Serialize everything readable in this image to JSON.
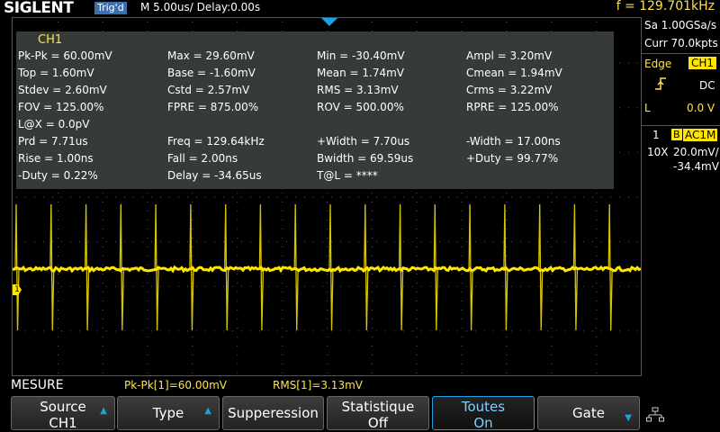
{
  "header": {
    "brand": "SIGLENT",
    "trigger_status": "Trig'd",
    "timebase": "M 5.00us/",
    "delay": "Delay:0.00s",
    "frequency": "f = 129.701kHz"
  },
  "measurements": {
    "channel": "CH1",
    "rows": [
      [
        "Pk-Pk = 60.00mV",
        "Max = 29.60mV",
        "Min = -30.40mV",
        "Ampl = 3.20mV"
      ],
      [
        "Top = 1.60mV",
        "Base = -1.60mV",
        "Mean = 1.74mV",
        "Cmean = 1.94mV"
      ],
      [
        "Stdev = 2.60mV",
        "Cstd = 2.57mV",
        "RMS = 3.13mV",
        "Crms = 3.22mV"
      ],
      [
        "FOV = 125.00%",
        "FPRE = 875.00%",
        "ROV = 500.00%",
        "RPRE = 125.00%"
      ],
      [
        "L@X = 0.0pV",
        "",
        "",
        ""
      ],
      [
        "Prd = 7.71us",
        "Freq = 129.64kHz",
        "+Width = 7.70us",
        "-Width = 17.00ns"
      ],
      [
        "Rise = 1.00ns",
        "Fall = 2.00ns",
        "Bwidth = 69.59us",
        "+Duty = 99.77%"
      ],
      [
        "-Duty = 0.22%",
        "Delay = -34.65us",
        "T@L = ****",
        ""
      ]
    ]
  },
  "waveform": {
    "channel_marker": "1",
    "color": "#ffe600",
    "spike_count": 18
  },
  "right_panel": {
    "sample_rate": "Sa 1.00GSa/s",
    "memory": "Curr 70.0kpts",
    "trigger_type": "Edge",
    "trigger_source": "CH1",
    "trigger_coupling": "DC",
    "trigger_level_label": "L",
    "trigger_level": "0.0 V",
    "channel_number": "1",
    "bandwidth_badge": "B",
    "coupling": "AC1M",
    "probe": "10X",
    "volts_div": "20.0mV/",
    "offset": "-34.4mV"
  },
  "status": {
    "menu_title": "MESURE",
    "stat1": "Pk-Pk[1]=60.00mV",
    "stat2": "RMS[1]=3.13mV"
  },
  "softkeys": {
    "source_l1": "Source",
    "source_l2": "CH1",
    "type": "Type",
    "suppression": "Supperession",
    "statistics_l1": "Statistique",
    "statistics_l2": "Off",
    "all_l1": "Toutes",
    "all_l2": "On",
    "gate": "Gate"
  },
  "colors": {
    "accent_blue": "#1ea0e0",
    "channel_yellow": "#ffe600",
    "panel_gray": "#3c403c"
  }
}
